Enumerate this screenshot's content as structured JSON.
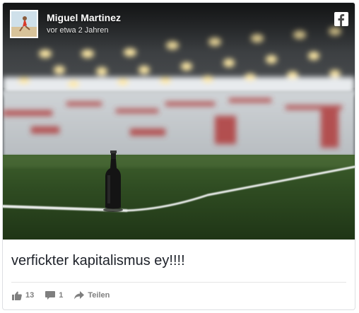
{
  "post": {
    "author": "Miguel Martinez",
    "timestamp": "vor etwa 2 Jahren",
    "caption": "verfickter kapitalismus ey!!!!"
  },
  "actions": {
    "like_count": "13",
    "comment_count": "1",
    "share_label": "Teilen"
  },
  "icons": {
    "brand": "facebook-icon",
    "like": "thumbs-up-icon",
    "comment": "speech-bubble-icon",
    "share": "share-arrow-icon"
  },
  "colors": {
    "caption_text": "#1d2129",
    "action_text": "#7f7f7f",
    "facebook_brand": "#3b5998"
  }
}
